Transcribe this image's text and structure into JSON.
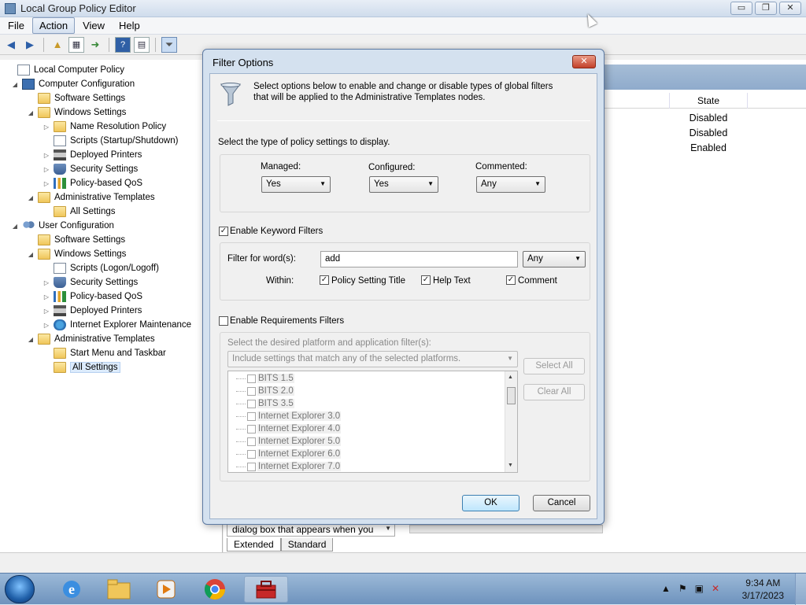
{
  "window": {
    "title": "Local Group Policy Editor",
    "btn_min": "▭",
    "btn_max": "❐",
    "btn_close": "✕"
  },
  "menu": [
    "File",
    "Action",
    "View",
    "Help"
  ],
  "tree": [
    {
      "label": "Local Computer Policy",
      "icon": "doc"
    },
    {
      "label": "Computer Configuration",
      "icon": "computer"
    },
    {
      "label": "Software Settings",
      "icon": "folder"
    },
    {
      "label": "Windows Settings",
      "icon": "folder"
    },
    {
      "label": "Name Resolution Policy",
      "icon": "folder"
    },
    {
      "label": "Scripts (Startup/Shutdown)",
      "icon": "doc"
    },
    {
      "label": "Deployed Printers",
      "icon": "printer"
    },
    {
      "label": "Security Settings",
      "icon": "shield"
    },
    {
      "label": "Policy-based QoS",
      "icon": "bars"
    },
    {
      "label": "Administrative Templates",
      "icon": "folder"
    },
    {
      "label": "All Settings",
      "icon": "folder"
    },
    {
      "label": "User Configuration",
      "icon": "users"
    },
    {
      "label": "Software Settings",
      "icon": "folder"
    },
    {
      "label": "Windows Settings",
      "icon": "folder"
    },
    {
      "label": "Scripts (Logon/Logoff)",
      "icon": "doc"
    },
    {
      "label": "Security Settings",
      "icon": "shield"
    },
    {
      "label": "Policy-based QoS",
      "icon": "bars"
    },
    {
      "label": "Deployed Printers",
      "icon": "printer"
    },
    {
      "label": "Internet Explorer Maintenance",
      "icon": "ie"
    },
    {
      "label": "Administrative Templates",
      "icon": "folder"
    },
    {
      "label": "Start Menu and Taskbar",
      "icon": "folder"
    },
    {
      "label": "All Settings",
      "icon": "folder"
    }
  ],
  "right": {
    "state_header": "State",
    "states": [
      "Disabled",
      "Disabled",
      "Enabled"
    ],
    "desc_combo": "dialog box that appears when you",
    "tabs": [
      "Extended",
      "Standard"
    ]
  },
  "dialog": {
    "title": "Filter Options",
    "close": "✕",
    "intro": "Select options below to enable and change or disable types of global filters that will be applied to the Administrative Templates nodes.",
    "type_label": "Select the type of policy settings to display.",
    "managed_label": "Managed:",
    "managed_value": "Yes",
    "configured_label": "Configured:",
    "configured_value": "Yes",
    "commented_label": "Commented:",
    "commented_value": "Any",
    "keyword_enabled_label": "Enable Keyword Filters",
    "filter_words_label": "Filter for word(s):",
    "filter_words_value": "add",
    "match_value": "Any",
    "within_label": "Within:",
    "within_title": "Policy Setting Title",
    "within_help": "Help Text",
    "within_comment": "Comment",
    "req_label": "Enable Requirements Filters",
    "platform_label": "Select the desired platform and application filter(s):",
    "platform_combo": "Include settings that match any of the selected platforms.",
    "platforms": [
      "BITS 1.5",
      "BITS 2.0",
      "BITS 3.5",
      "Internet Explorer 3.0",
      "Internet Explorer 4.0",
      "Internet Explorer 5.0",
      "Internet Explorer 6.0",
      "Internet Explorer 7.0"
    ],
    "select_all": "Select All",
    "clear_all": "Clear All",
    "ok": "OK",
    "cancel": "Cancel"
  },
  "taskbar": {
    "time": "9:34 AM",
    "date": "3/17/2023"
  }
}
